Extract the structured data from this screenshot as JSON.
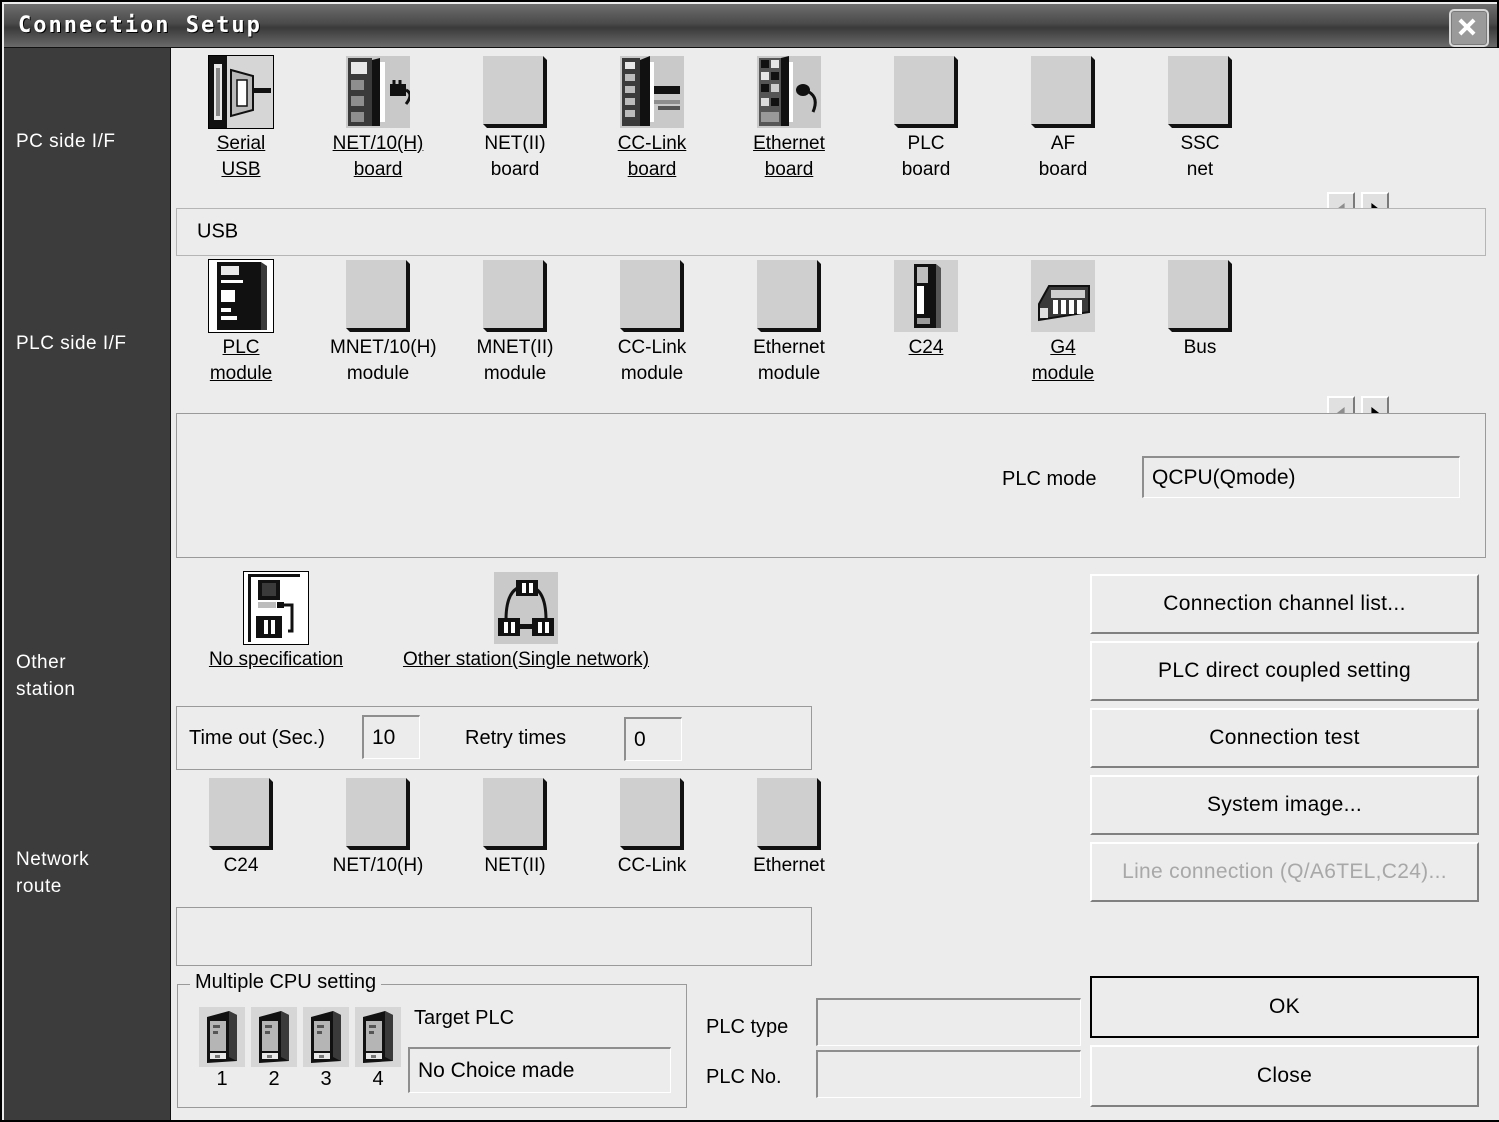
{
  "window": {
    "title": "Connection Setup",
    "close_icon": "close-icon"
  },
  "sidebar": {
    "labels": [
      {
        "id": "pc-side-if",
        "text": "PC side I/F"
      },
      {
        "id": "plc-side-if",
        "text": "PLC side I/F"
      },
      {
        "id": "other-station",
        "line1": "Other",
        "line2": "station"
      },
      {
        "id": "network-route",
        "line1": "Network",
        "line2": "route"
      }
    ]
  },
  "pc_side": {
    "items": [
      {
        "line1": "Serial",
        "line2": "USB",
        "selected": true,
        "underlined": true,
        "icon": "serial-usb-icon"
      },
      {
        "line1": "NET/10(H)",
        "line2": "board",
        "selected": false,
        "underlined": true,
        "icon": "net10h-board-icon"
      },
      {
        "line1": "NET(II)",
        "line2": "board",
        "selected": false,
        "underlined": false,
        "icon": "netii-board-icon"
      },
      {
        "line1": "CC-Link",
        "line2": "board",
        "selected": false,
        "underlined": true,
        "icon": "cclink-board-icon"
      },
      {
        "line1": "Ethernet",
        "line2": "board",
        "selected": false,
        "underlined": true,
        "icon": "ethernet-board-icon"
      },
      {
        "line1": "PLC",
        "line2": "board",
        "selected": false,
        "underlined": false,
        "icon": "plc-board-icon"
      },
      {
        "line1": "AF",
        "line2": "board",
        "selected": false,
        "underlined": false,
        "icon": "af-board-icon"
      },
      {
        "line1": "SSC",
        "line2": "net",
        "selected": false,
        "underlined": false,
        "icon": "sscnet-icon"
      }
    ],
    "value_strip": "USB",
    "scroll_left_icon": "arrow-left-icon",
    "scroll_right_icon": "arrow-right-icon"
  },
  "plc_side": {
    "items": [
      {
        "line1": "PLC",
        "line2": "module",
        "selected": true,
        "underlined": true,
        "icon": "plc-module-icon"
      },
      {
        "line1": "MNET/10(H)",
        "line2": "module",
        "selected": false,
        "underlined": false,
        "icon": "mnet10h-module-icon"
      },
      {
        "line1": "MNET(II)",
        "line2": "module",
        "selected": false,
        "underlined": false,
        "icon": "mnetii-module-icon"
      },
      {
        "line1": "CC-Link",
        "line2": "module",
        "selected": false,
        "underlined": false,
        "icon": "cclink-module-icon"
      },
      {
        "line1": "Ethernet",
        "line2": "module",
        "selected": false,
        "underlined": false,
        "icon": "ethernet-module-icon"
      },
      {
        "line1": "C24",
        "line2": "",
        "selected": false,
        "underlined": true,
        "icon": "c24-module-icon"
      },
      {
        "line1": "G4",
        "line2": "module",
        "selected": false,
        "underlined": true,
        "icon": "g4-module-icon"
      },
      {
        "line1": "Bus",
        "line2": "",
        "selected": false,
        "underlined": false,
        "icon": "bus-module-icon"
      }
    ],
    "plc_mode_label": "PLC mode",
    "plc_mode_value": "QCPU(Qmode)",
    "scroll_left_icon": "arrow-left-icon",
    "scroll_right_icon": "arrow-right-icon"
  },
  "other_station": {
    "items": [
      {
        "label": "No specification",
        "selected": true,
        "icon": "no-specification-icon"
      },
      {
        "label": "Other station(Single network)",
        "selected": false,
        "icon": "other-station-single-network-icon"
      }
    ],
    "timeout_label": "Time out (Sec.)",
    "timeout_value": "10",
    "retry_label": "Retry times",
    "retry_value": "0"
  },
  "network_route": {
    "items": [
      {
        "label": "C24",
        "icon": "c24-route-icon"
      },
      {
        "label": "NET/10(H)",
        "icon": "net10h-route-icon"
      },
      {
        "label": "NET(II)",
        "icon": "netii-route-icon"
      },
      {
        "label": "CC-Link",
        "icon": "cclink-route-icon"
      },
      {
        "label": "Ethernet",
        "icon": "ethernet-route-icon"
      }
    ],
    "value_strip": ""
  },
  "multiple_cpu": {
    "title": "Multiple CPU setting",
    "cpus": [
      {
        "number": "1",
        "icon": "cpu-tower-icon"
      },
      {
        "number": "2",
        "icon": "cpu-tower-icon"
      },
      {
        "number": "3",
        "icon": "cpu-tower-icon"
      },
      {
        "number": "4",
        "icon": "cpu-tower-icon"
      }
    ],
    "target_plc_label": "Target PLC",
    "target_plc_value": "No Choice made"
  },
  "plc_info": {
    "type_label": "PLC type",
    "type_value": "",
    "no_label": "PLC No.",
    "no_value": ""
  },
  "actions": {
    "connection_channel_list": "Connection  channel  list...",
    "plc_direct_coupled_setting": "PLC direct coupled setting",
    "connection_test": "Connection test",
    "system_image": "System   image...",
    "line_connection": "Line connection (Q/A6TEL,C24)...",
    "line_connection_disabled": true,
    "ok": "OK",
    "close": "Close"
  },
  "colors": {
    "titlebar": "#4a4a4a",
    "sidebar": "#3c3c3c",
    "face": "#ececec",
    "icon_fill": "#cfcfcf"
  }
}
